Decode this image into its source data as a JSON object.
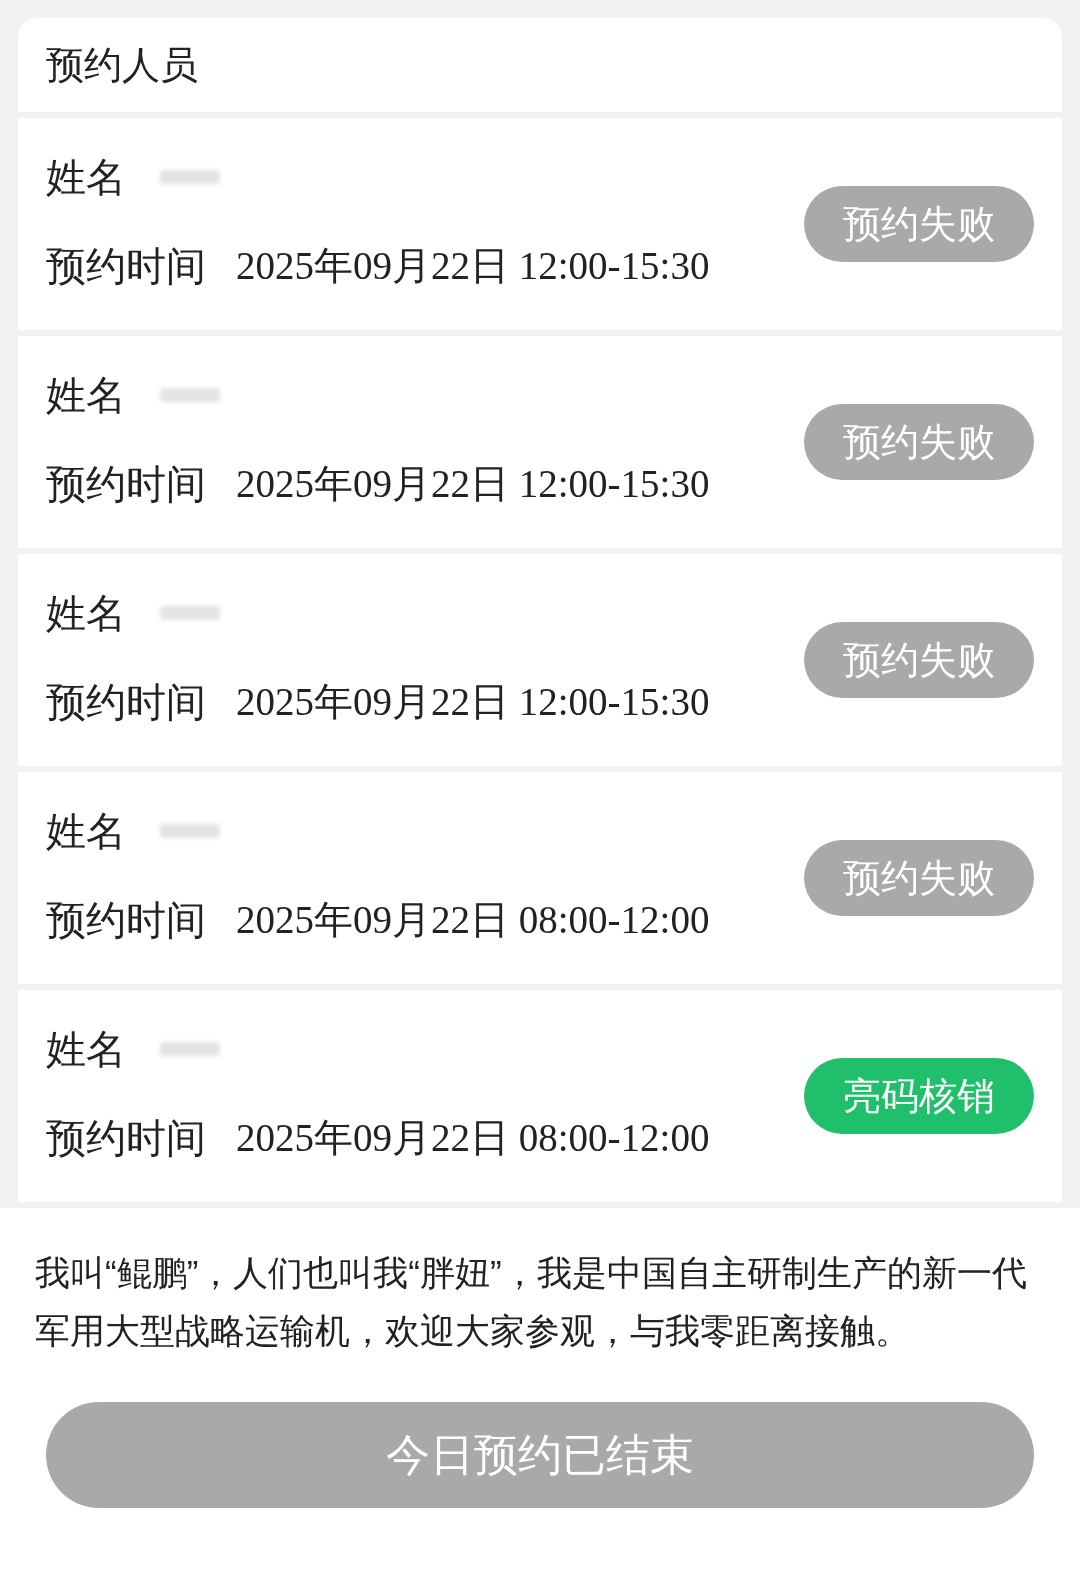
{
  "section": {
    "title": "预约人员"
  },
  "reservations": [
    {
      "name_label": "姓名",
      "time_label": "预约时间",
      "time": "2025年09月22日 12:00-15:30",
      "action": {
        "label": "预约失败",
        "kind": "failed"
      }
    },
    {
      "name_label": "姓名",
      "time_label": "预约时间",
      "time": "2025年09月22日 12:00-15:30",
      "action": {
        "label": "预约失败",
        "kind": "failed"
      }
    },
    {
      "name_label": "姓名",
      "time_label": "预约时间",
      "time": "2025年09月22日 12:00-15:30",
      "action": {
        "label": "预约失败",
        "kind": "failed"
      }
    },
    {
      "name_label": "姓名",
      "time_label": "预约时间",
      "time": "2025年09月22日 08:00-12:00",
      "action": {
        "label": "预约失败",
        "kind": "failed"
      }
    },
    {
      "name_label": "姓名",
      "time_label": "预约时间",
      "time": "2025年09月22日 08:00-12:00",
      "action": {
        "label": "亮码核销",
        "kind": "verify"
      }
    }
  ],
  "description": "我叫“鲲鹏”，人们也叫我“胖妞”，我是中国自主研制生产的新一代军用大型战略运输机，欢迎大家参观，与我零距离接触。",
  "footer_button": {
    "label": "今日预约已结束",
    "disabled": true
  }
}
